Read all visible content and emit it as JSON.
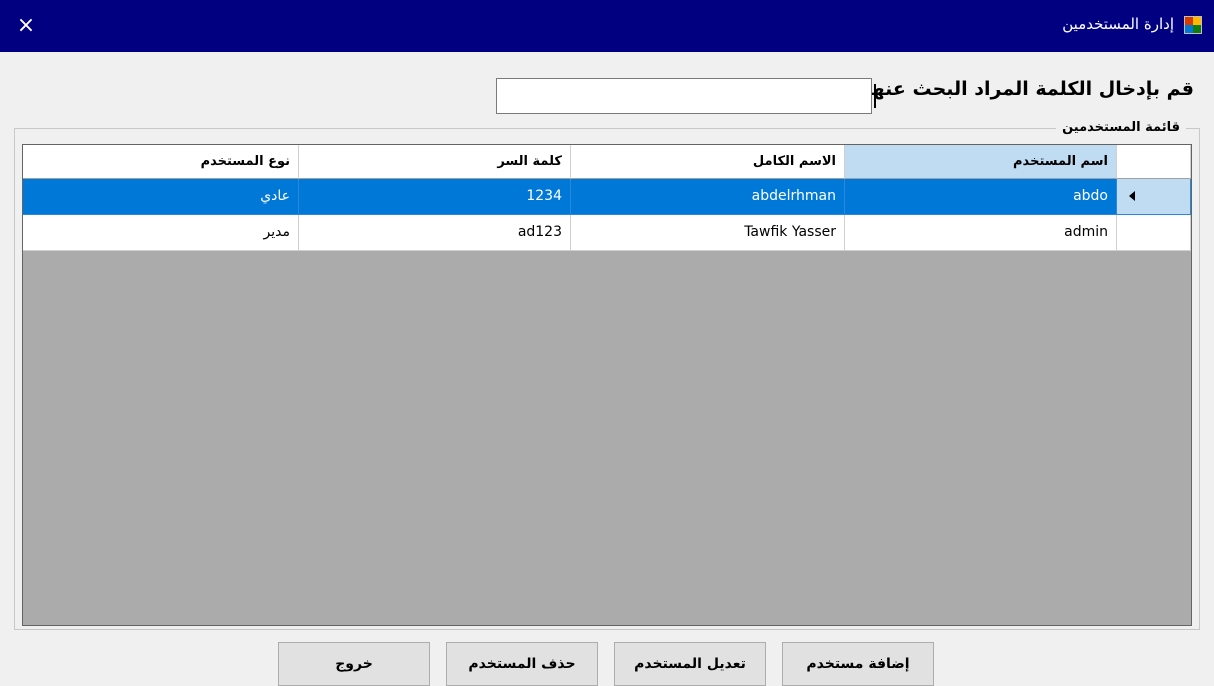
{
  "window": {
    "title": "إدارة المستخدمين",
    "close_label": "×"
  },
  "search": {
    "label": "قم بإدخال الكلمة المراد البحث عنها:",
    "value": "",
    "placeholder": ""
  },
  "group": {
    "legend": "قائمة المستخدمين"
  },
  "table": {
    "columns": [
      "اسم المستخدم",
      "الاسم الكامل",
      "كلمة السر",
      "نوع المستخدم"
    ],
    "rows": [
      {
        "username": "abdo",
        "fullname": "abdelrhman",
        "password": "1234",
        "type": "عادي",
        "selected": true
      },
      {
        "username": "admin",
        "fullname": "Tawfik Yasser",
        "password": "ad123",
        "type": "مدير",
        "selected": false
      }
    ]
  },
  "buttons": {
    "add": "إضافة مستخدم",
    "edit": "تعديل المستخدم",
    "delete": "حذف المستخدم",
    "exit": "خروج"
  },
  "colors": {
    "titlebar": "#000080",
    "selection": "#0078d7",
    "header_active": "#c0dcf3",
    "grid_bg": "#ababab"
  },
  "icons": {
    "app": "app-window-icon",
    "close": "close-icon",
    "row_pointer": "row-pointer-icon"
  }
}
